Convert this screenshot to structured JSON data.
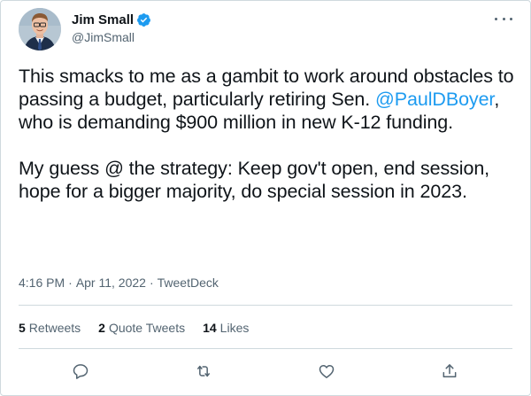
{
  "author": {
    "display_name": "Jim Small",
    "handle": "@JimSmall",
    "verified": true
  },
  "tweet": {
    "paragraph1_before": "This smacks to me as a gambit to work around obstacles to passing a budget, particularly retiring Sen. ",
    "mention": "@PaulDBoyer",
    "paragraph1_after": ", who is demanding $900 million in new K-12 funding.",
    "paragraph2": "My guess @ the strategy: Keep gov't open, end session, hope for a bigger majority, do special session in 2023.",
    "time": "4:16 PM",
    "date": "Apr 11, 2022",
    "source": "TweetDeck",
    "separator": "·"
  },
  "stats": {
    "retweets_count": "5",
    "retweets_label": "Retweets",
    "quotes_count": "2",
    "quotes_label": "Quote Tweets",
    "likes_count": "14",
    "likes_label": "Likes"
  },
  "icons": {
    "verified": "verified-badge-icon",
    "more": "more-horizontal-icon",
    "reply": "reply-icon",
    "retweet": "retweet-icon",
    "like": "heart-icon",
    "share": "share-icon"
  },
  "colors": {
    "accent": "#1d9bf0",
    "text": "#0f1419",
    "secondary_text": "#536471",
    "border": "#cfd9de"
  }
}
